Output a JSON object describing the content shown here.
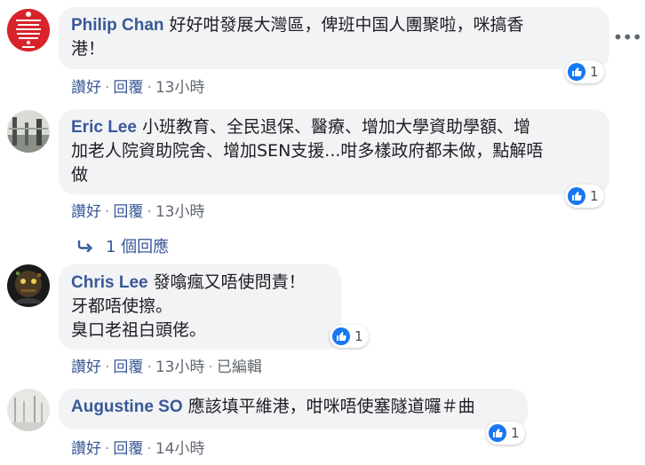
{
  "comments": [
    {
      "author": "Philip Chan",
      "text": "好好咁發展大灣區，俾班中国人團聚啦，咪搞香\n港！",
      "avatar_text": "I CAN'T KEEP CALM BECAUSE HONG KONG IS DYING",
      "like_label": "讚好",
      "reply_label": "回覆",
      "time": "13小時",
      "reactions": "1"
    },
    {
      "author": "Eric Lee",
      "text": "小班教育、全民退保、醫療、增加大學資助學額、增\n加老人院資助院舍、增加SEN支援...咁多樣政府都未做，點解唔\n做",
      "like_label": "讚好",
      "reply_label": "回覆",
      "time": "13小時",
      "reactions": "1",
      "replies_label": "1 個回應"
    },
    {
      "author": "Chris Lee",
      "text": "發噏瘋又唔使問責！\n牙都唔使擦。\n臭口老祖白頭佬。",
      "like_label": "讚好",
      "reply_label": "回覆",
      "time": "13小時",
      "edited": "已編輯",
      "reactions": "1"
    },
    {
      "author": "Augustine SO",
      "text": "應該填平維港，咁咪唔使塞隧道囉＃曲",
      "like_label": "讚好",
      "reply_label": "回覆",
      "time": "14小時",
      "reactions": "1"
    }
  ],
  "icons": {
    "like": "thumbs-up-icon",
    "reply_arrow": "reply-arrow-icon",
    "more": "more-icon"
  },
  "colors": {
    "link": "#385898",
    "bubble": "#f2f3f5",
    "like": "#1877f2"
  }
}
